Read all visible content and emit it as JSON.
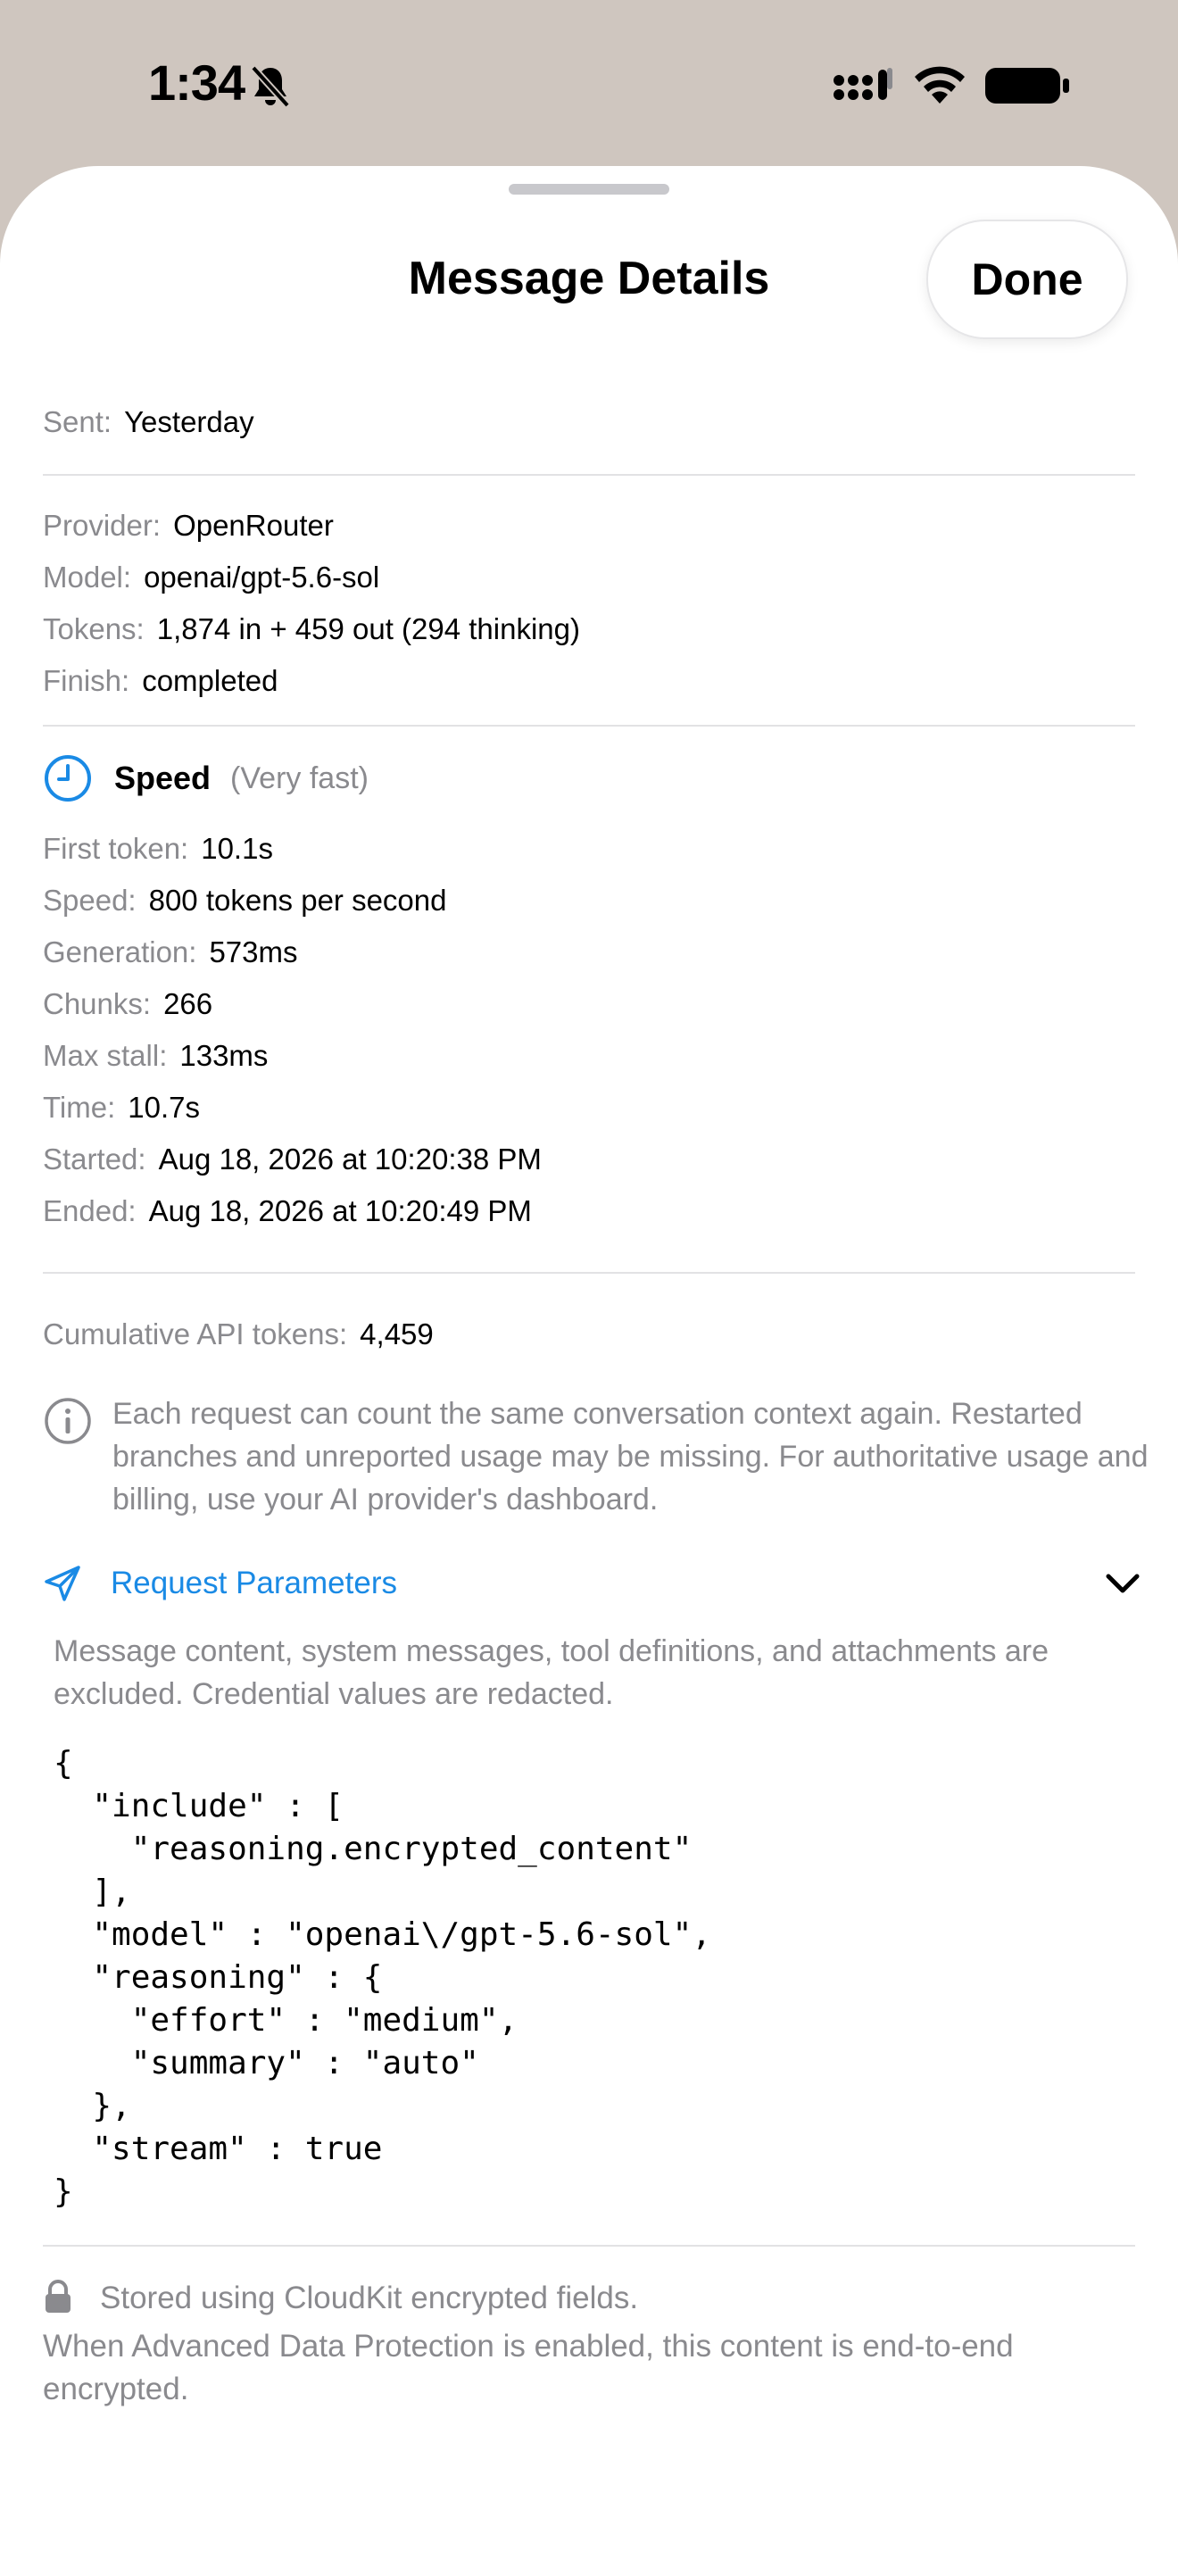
{
  "status_bar": {
    "time": "1:34",
    "bell_icon": "bell-slash-icon",
    "cellular_icon": "cellular-signal-icon",
    "wifi_icon": "wifi-icon",
    "battery_icon": "battery-icon"
  },
  "sheet": {
    "title": "Message Details",
    "done_label": "Done"
  },
  "sent": {
    "label": "Sent:",
    "value": "Yesterday"
  },
  "meta": {
    "provider": {
      "label": "Provider:",
      "value": "OpenRouter"
    },
    "model": {
      "label": "Model:",
      "value": "openai/gpt-5.6-sol"
    },
    "tokens": {
      "label": "Tokens:",
      "value": "1,874 in + 459 out (294 thinking)"
    },
    "finish": {
      "label": "Finish:",
      "value": "completed"
    }
  },
  "speed": {
    "icon": "clock-icon",
    "title": "Speed",
    "qualifier": "(Very fast)",
    "first_token": {
      "label": "First token:",
      "value": "10.1s"
    },
    "speed": {
      "label": "Speed:",
      "value": "800 tokens per second"
    },
    "generation": {
      "label": "Generation:",
      "value": "573ms"
    },
    "chunks": {
      "label": "Chunks:",
      "value": "266"
    },
    "max_stall": {
      "label": "Max stall:",
      "value": "133ms"
    },
    "time": {
      "label": "Time:",
      "value": "10.7s"
    },
    "started": {
      "label": "Started:",
      "value": "Aug 18, 2026 at 10:20:38 PM"
    },
    "ended": {
      "label": "Ended:",
      "value": "Aug 18, 2026 at 10:20:49 PM"
    }
  },
  "cumulative": {
    "label": "Cumulative API tokens:",
    "value": "4,459"
  },
  "info_note": {
    "icon": "info-circle-icon",
    "text": "Each request can count the same conversation context again. Restarted branches and unreported usage may be missing. For authoritative usage and billing, use your AI provider's dashboard."
  },
  "request_parameters": {
    "icon": "paper-plane-icon",
    "label": "Request Parameters",
    "chevron": "chevron-down-icon",
    "description": "Message content, system messages, tool definitions, and attachments are excluded. Credential values are redacted.",
    "json": "{\n  \"include\" : [\n    \"reasoning.encrypted_content\"\n  ],\n  \"model\" : \"openai\\/gpt-5.6-sol\",\n  \"reasoning\" : {\n    \"effort\" : \"medium\",\n    \"summary\" : \"auto\"\n  },\n  \"stream\" : true\n}"
  },
  "footer": {
    "icon": "lock-icon",
    "line1": "Stored using CloudKit encrypted fields.",
    "line2": "When Advanced Data Protection is enabled, this content is end-to-end encrypted."
  },
  "colors": {
    "accent": "#1a8ae5",
    "secondary_text": "#8a8a8e",
    "backdrop": "#cfc6bf"
  }
}
